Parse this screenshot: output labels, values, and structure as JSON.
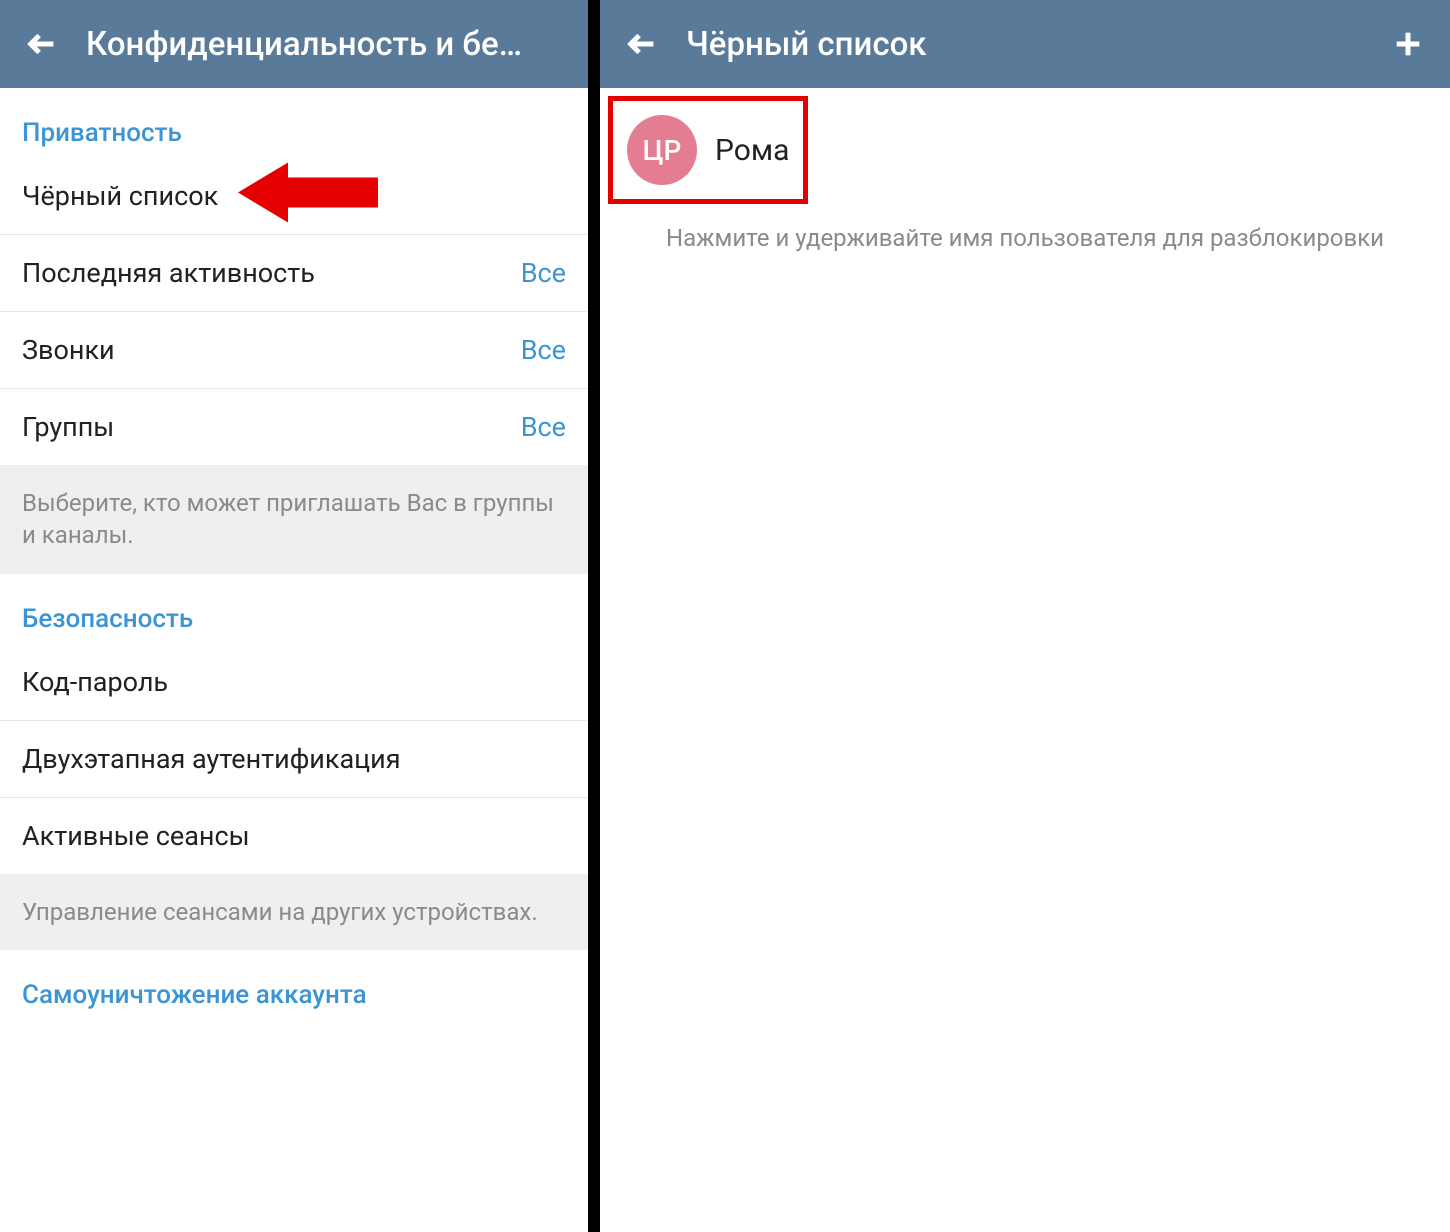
{
  "left": {
    "header_title": "Конфиденциальность и бе…",
    "sections": {
      "privacy": {
        "title": "Приватность",
        "blacklist": "Чёрный список",
        "last_seen": {
          "label": "Последняя активность",
          "value": "Все"
        },
        "calls": {
          "label": "Звонки",
          "value": "Все"
        },
        "groups": {
          "label": "Группы",
          "value": "Все"
        },
        "hint": "Выберите, кто может приглашать Вас в группы и каналы."
      },
      "security": {
        "title": "Безопасность",
        "passcode": "Код-пароль",
        "twostep": "Двухэтапная аутентификация",
        "sessions": "Активные сеансы",
        "hint": "Управление сеансами на других устройствах."
      },
      "self_destruct": {
        "title": "Самоуничтожение аккаунта"
      }
    }
  },
  "right": {
    "header_title": "Чёрный список",
    "contact": {
      "initials": "ЦР",
      "name": "Рома",
      "avatar_color": "#e57d92"
    },
    "hint": "Нажмите и удерживайте имя пользователя для разблокировки"
  },
  "colors": {
    "header_bg": "#5a7a99",
    "accent": "#3b95d4",
    "annotation_red": "#e50000"
  }
}
